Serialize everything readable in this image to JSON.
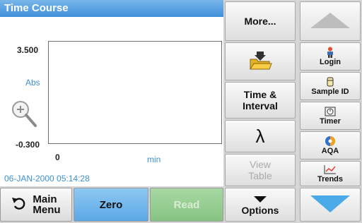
{
  "header": {
    "title": "Time Course"
  },
  "plot": {
    "y_max": "3.500",
    "y_min": "-0.300",
    "y_label": "Abs",
    "x_start": "0",
    "x_label": "min",
    "timestamp": "06-JAN-2000  05:14:28"
  },
  "middle": {
    "more": "More...",
    "time_interval_line1": "Time &",
    "time_interval_line2": "Interval",
    "lambda": "λ",
    "view_table_line1": "View",
    "view_table_line2": "Table",
    "options": "Options"
  },
  "sidebar": {
    "login": "Login",
    "sample_id": "Sample ID",
    "timer": "Timer",
    "aqa": "AQA",
    "trends": "Trends"
  },
  "bottom": {
    "main_menu_line1": "Main",
    "main_menu_line2": "Menu",
    "zero": "Zero",
    "read": "Read"
  },
  "colors": {
    "title_bar": "#3f8fd8",
    "accent_text": "#3b8fd6",
    "zero_button": "#5aa8e6",
    "read_button": "#86c482",
    "arrow_up": "#bdbdbd",
    "arrow_down": "#4aaae8"
  }
}
